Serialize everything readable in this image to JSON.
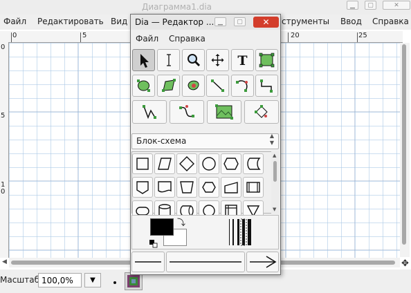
{
  "bg_window": {
    "title": "Диаграмма1.dia",
    "menu": [
      "Файл",
      "Редактировать",
      "Вид",
      "струменты",
      "Ввод",
      "Справка"
    ],
    "ruler_h_labels": [
      "0",
      "5",
      "20",
      "25"
    ],
    "ruler_v_labels": [
      "0",
      "5",
      "1",
      "0"
    ],
    "zoom_label": "Масштаб",
    "zoom_value": "100,0%"
  },
  "toolbox": {
    "title": "Dia — Редактор ...",
    "menu": [
      "Файл",
      "Справка"
    ],
    "tools": [
      {
        "name": "pointer-tool-icon",
        "selected": true
      },
      {
        "name": "text-cursor-tool-icon"
      },
      {
        "name": "magnify-tool-icon"
      },
      {
        "name": "scroll-tool-icon"
      },
      {
        "name": "text-tool-icon",
        "glyph": "T"
      },
      {
        "name": "box-tool-icon"
      },
      {
        "name": "ellipse-tool-icon"
      },
      {
        "name": "polygon-tool-icon"
      },
      {
        "name": "beziergon-tool-icon"
      },
      {
        "name": "line-tool-icon"
      },
      {
        "name": "arc-tool-icon"
      },
      {
        "name": "zigzag-tool-icon"
      },
      {
        "name": "polyline-tool-icon"
      },
      {
        "name": "bezierline-tool-icon"
      },
      {
        "name": "image-tool-icon"
      },
      {
        "name": "outline-tool-icon"
      }
    ],
    "sheet": "Блок-схема",
    "shapes": [
      "rectangle-shape-icon",
      "parallelogram-shape-icon",
      "diamond-shape-icon",
      "circle-shape-icon",
      "hexagon-shape-icon",
      "stored-data-shape-icon",
      "offpage-shape-icon",
      "document-shape-icon",
      "trapezoid-shape-icon",
      "preparation-shape-icon",
      "manual-input-shape-icon",
      "predefined-process-shape-icon",
      "terminal-shape-icon",
      "cylinder-shape-icon",
      "direct-data-shape-icon",
      "connector-shape-icon",
      "internal-storage-shape-icon",
      "merge-shape-icon"
    ],
    "colors": {
      "foreground": "#000000",
      "background": "#ffffff"
    }
  }
}
